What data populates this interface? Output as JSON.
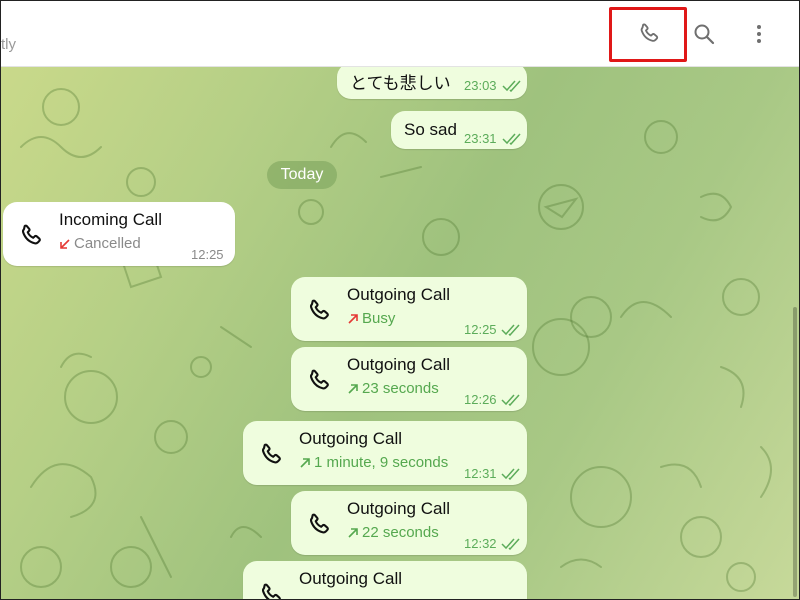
{
  "header": {
    "status": "tly",
    "call_icon": "phone-icon",
    "search_icon": "search-icon",
    "more_icon": "more-vertical-icon"
  },
  "chat": {
    "date_separator": "Today",
    "messages": [
      {
        "text": "とても悲しい",
        "time": "23:03"
      },
      {
        "text": "So sad",
        "time": "23:31"
      }
    ],
    "calls": [
      {
        "title": "Incoming Call",
        "status": "Cancelled",
        "time": "12:25",
        "direction": "incoming-missed"
      },
      {
        "title": "Outgoing Call",
        "status": "Busy",
        "time": "12:25",
        "direction": "outgoing-failed"
      },
      {
        "title": "Outgoing Call",
        "status": "23 seconds",
        "time": "12:26",
        "direction": "outgoing"
      },
      {
        "title": "Outgoing Call",
        "status": "1 minute, 9 seconds",
        "time": "12:31",
        "direction": "outgoing"
      },
      {
        "title": "Outgoing Call",
        "status": "22 seconds",
        "time": "12:32",
        "direction": "outgoing"
      },
      {
        "title": "Outgoing Call",
        "status": "",
        "time": "",
        "direction": "outgoing"
      }
    ]
  },
  "colors": {
    "highlight": "#e01818",
    "bubble_out": "#effdde",
    "bubble_in": "#ffffff",
    "accent_green": "#55a84f",
    "missed_red": "#e53935"
  }
}
